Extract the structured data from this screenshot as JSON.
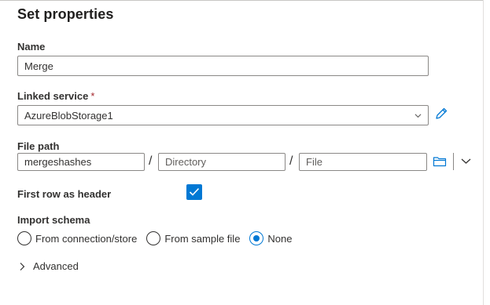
{
  "panel": {
    "title": "Set properties"
  },
  "name_field": {
    "label": "Name",
    "value": "Merge"
  },
  "linked_service": {
    "label": "Linked service",
    "required_marker": "*",
    "value": "AzureBlobStorage1"
  },
  "file_path": {
    "label": "File path",
    "container_value": "mergeshashes",
    "separator": "/",
    "directory_placeholder": "Directory",
    "file_placeholder": "File"
  },
  "first_row_header": {
    "label": "First row as header",
    "checked": true
  },
  "import_schema": {
    "label": "Import schema",
    "options": [
      {
        "label": "From connection/store",
        "selected": false
      },
      {
        "label": "From sample file",
        "selected": false
      },
      {
        "label": "None",
        "selected": true
      }
    ]
  },
  "advanced": {
    "label": "Advanced"
  },
  "colors": {
    "accent": "#0078d4",
    "required": "#a4262c"
  }
}
